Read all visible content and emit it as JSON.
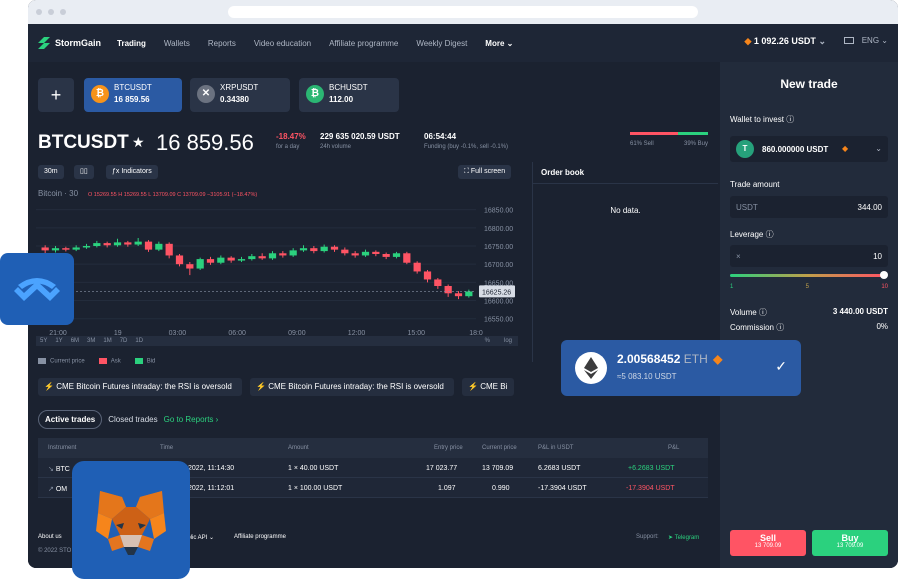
{
  "app": {
    "name": "StormGain",
    "balance": "1 092.26 USDT",
    "language": "ENG"
  },
  "nav": [
    {
      "label": "Trading",
      "active": true
    },
    {
      "label": "Wallets"
    },
    {
      "label": "Reports"
    },
    {
      "label": "Video education"
    },
    {
      "label": "Affiliate programme"
    },
    {
      "label": "Weekly Digest"
    },
    {
      "label": "More"
    }
  ],
  "tickers": [
    {
      "symbol": "BTCUSDT",
      "price": "16 859.56",
      "active": true,
      "color": "#f7931a",
      "glyph": "₿"
    },
    {
      "symbol": "XRPUSDT",
      "price": "0.34380",
      "color": "#6b7280",
      "glyph": "✕"
    },
    {
      "symbol": "BCHUSDT",
      "price": "112.00",
      "color": "#2bb673",
      "glyph": "₿"
    }
  ],
  "pair": {
    "title": "BTCUSDT",
    "price": "16 859.56",
    "change": "-18.47%",
    "change_label": "for a day",
    "volume": "229 635 020.59 USDT",
    "volume_label": "24h volume",
    "time": "06:54:44",
    "funding": "Funding (buy -0.1%, sell -0.1%)",
    "sell_ratio_label": "61% Sell",
    "buy_ratio_label": "39% Buy",
    "sell_ratio": 61,
    "buy_ratio": 39
  },
  "chart_toolbar": {
    "interval": "30m",
    "indicators": "Indicators",
    "fullscreen": "Full screen"
  },
  "chart_data": {
    "type": "candlestick",
    "title": "Bitcoin · 30",
    "ohlc_label": "O 15269.55 H 15269.55 L 13709.09 C 13709.09 −3105.91 (−18.47%)",
    "x_ticks": [
      "21:00",
      "19",
      "03:00",
      "06:00",
      "09:00",
      "12:00",
      "15:00",
      "18:0"
    ],
    "y_ticks": [
      "16850.00",
      "16800.00",
      "16750.00",
      "16700.00",
      "16650.00",
      "16600.00",
      "16550.00"
    ],
    "ylim": [
      16530,
      16860
    ],
    "last_price": "16625.26",
    "candles": [
      [
        16746,
        16738,
        16752,
        16730
      ],
      [
        16738,
        16744,
        16750,
        16732
      ],
      [
        16744,
        16740,
        16748,
        16735
      ],
      [
        16740,
        16746,
        16752,
        16736
      ],
      [
        16746,
        16750,
        16756,
        16742
      ],
      [
        16750,
        16758,
        16764,
        16746
      ],
      [
        16758,
        16752,
        16762,
        16746
      ],
      [
        16752,
        16760,
        16770,
        16748
      ],
      [
        16760,
        16754,
        16764,
        16748
      ],
      [
        16754,
        16762,
        16772,
        16750
      ],
      [
        16762,
        16740,
        16766,
        16734
      ],
      [
        16740,
        16756,
        16762,
        16736
      ],
      [
        16756,
        16724,
        16760,
        16716
      ],
      [
        16724,
        16700,
        16728,
        16694
      ],
      [
        16700,
        16688,
        16706,
        16670
      ],
      [
        16688,
        16714,
        16718,
        16684
      ],
      [
        16714,
        16704,
        16720,
        16698
      ],
      [
        16704,
        16718,
        16724,
        16700
      ],
      [
        16718,
        16710,
        16722,
        16704
      ],
      [
        16710,
        16714,
        16720,
        16706
      ],
      [
        16714,
        16722,
        16728,
        16710
      ],
      [
        16722,
        16716,
        16730,
        16712
      ],
      [
        16716,
        16730,
        16736,
        16712
      ],
      [
        16730,
        16724,
        16736,
        16718
      ],
      [
        16724,
        16738,
        16744,
        16720
      ],
      [
        16738,
        16744,
        16752,
        16734
      ],
      [
        16744,
        16736,
        16750,
        16730
      ],
      [
        16736,
        16748,
        16754,
        16732
      ],
      [
        16748,
        16740,
        16752,
        16734
      ],
      [
        16740,
        16730,
        16746,
        16724
      ],
      [
        16730,
        16724,
        16736,
        16718
      ],
      [
        16724,
        16734,
        16740,
        16720
      ],
      [
        16734,
        16728,
        16738,
        16722
      ],
      [
        16728,
        16720,
        16732,
        16714
      ],
      [
        16720,
        16730,
        16734,
        16716
      ],
      [
        16730,
        16704,
        16734,
        16700
      ],
      [
        16704,
        16680,
        16708,
        16674
      ],
      [
        16680,
        16658,
        16684,
        16650
      ],
      [
        16658,
        16640,
        16662,
        16632
      ],
      [
        16640,
        16620,
        16644,
        16610
      ],
      [
        16620,
        16612,
        16626,
        16604
      ],
      [
        16612,
        16625,
        16630,
        16608
      ]
    ],
    "legend": [
      "Current price",
      "Ask",
      "Bid"
    ],
    "range_buttons": [
      "5Y",
      "1Y",
      "6M",
      "3M",
      "1M",
      "7D",
      "1D"
    ],
    "scale_labels": [
      "%",
      "log"
    ]
  },
  "orderbook": {
    "title": "Order book",
    "empty": "No data."
  },
  "news": [
    "CME Bitcoin Futures intraday: the RSI is oversold",
    "CME Bitcoin Futures intraday: the RSI is oversold",
    "CME Bi"
  ],
  "trades_tabs": {
    "active": "Active trades",
    "closed": "Closed trades",
    "reports": "Go to Reports ›"
  },
  "table": {
    "headers": [
      "Instrument",
      "Time",
      "Amount",
      "Entry price",
      "Current price",
      "P&L in USDT",
      "P&L"
    ],
    "rows": [
      {
        "instrument": "BTC",
        "time": "2022, 11:14:30",
        "amount": "1 × 40.00 USDT",
        "entry": "17 023.77",
        "current": "13 709.09",
        "pnl_usdt": "6.2683 USDT",
        "pnl": "+6.2683 USDT",
        "pnl_color": "#2bd17e"
      },
      {
        "instrument": "OM",
        "time": "2022, 11:12:01",
        "amount": "1 × 100.00 USDT",
        "entry": "1.097",
        "current": "0.990",
        "pnl_usdt": "-17.3904 USDT",
        "pnl": "-17.3904 USDT",
        "pnl_color": "#ff5464"
      }
    ]
  },
  "footer": {
    "about": "About us",
    "copyright": "© 2022 STO",
    "api": "ublic API",
    "affiliate": "Affiliate programme",
    "support": "Support:",
    "telegram": "Telegram"
  },
  "new_trade": {
    "title": "New trade",
    "wallet_label": "Wallet to invest",
    "wallet_value": "860.000000 USDT",
    "amount_label": "Trade amount",
    "amount_currency": "USDT",
    "amount_value": "344.00",
    "leverage_label": "Leverage",
    "leverage_prefix": "×",
    "leverage_value": "10",
    "leverage_ticks": [
      "1",
      "5",
      "10"
    ],
    "volume_label": "Volume",
    "volume_value": "3 440.00 USDT",
    "commission_label": "Commission",
    "commission_value": "0%",
    "sell_label": "Sell",
    "sell_price": "13 709.09",
    "buy_label": "Buy",
    "buy_price": "13 709.09"
  },
  "eth_card": {
    "amount": "2.00568452",
    "unit": "ETH",
    "fiat": "≈5 083.10 USDT"
  }
}
